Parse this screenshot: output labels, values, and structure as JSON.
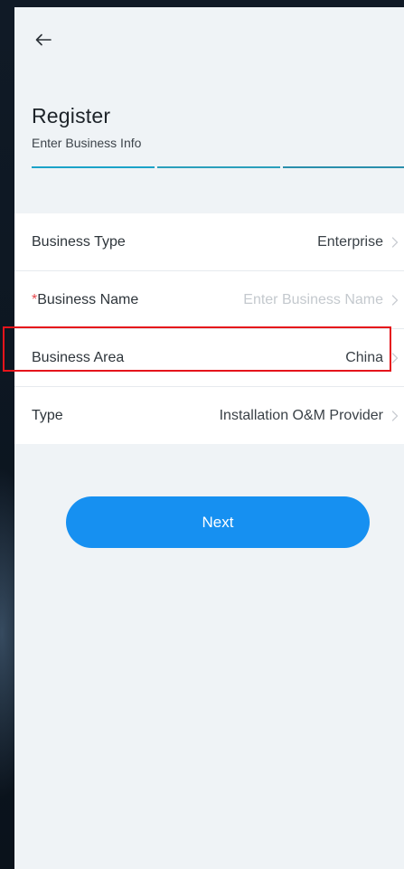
{
  "header": {
    "back_icon": "arrow-left-icon",
    "title": "Register",
    "subtitle": "Enter Business Info",
    "steps": {
      "total": 3,
      "current": 1
    }
  },
  "form": {
    "rows": [
      {
        "label": "Business Type",
        "required": false,
        "value": "Enterprise",
        "is_placeholder": false
      },
      {
        "label": "Business Name",
        "required": true,
        "required_mark": "*",
        "value": "Enter Business Name",
        "is_placeholder": true
      },
      {
        "label": "Business Area",
        "required": false,
        "value": "China",
        "is_placeholder": false,
        "highlighted": true
      },
      {
        "label": "Type",
        "required": false,
        "value": "Installation O&M Provider",
        "is_placeholder": false
      }
    ],
    "chevron_icon": "chevron-right-icon"
  },
  "actions": {
    "next_label": "Next"
  },
  "colors": {
    "accent": "#1690f1",
    "step_line": "#1aa3c8",
    "highlight_border": "#e5141b",
    "required_mark": "#e5484d",
    "placeholder": "#c4c9ce",
    "screen_bg": "#eff3f6"
  }
}
